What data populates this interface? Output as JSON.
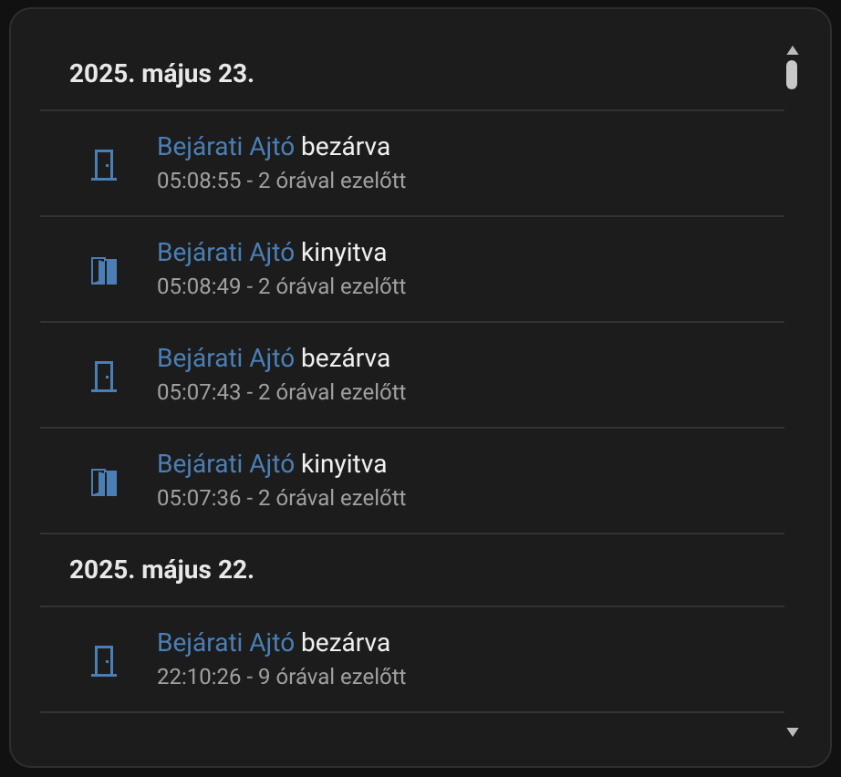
{
  "groups": [
    {
      "date": "2025. május 23.",
      "entries": [
        {
          "entity": "Bejárati Ajtó",
          "state": "bezárva",
          "kind": "closed",
          "time": "05:08:55 - 2 órával ezelőtt"
        },
        {
          "entity": "Bejárati Ajtó",
          "state": "kinyitva",
          "kind": "open",
          "time": "05:08:49 - 2 órával ezelőtt"
        },
        {
          "entity": "Bejárati Ajtó",
          "state": "bezárva",
          "kind": "closed",
          "time": "05:07:43 - 2 órával ezelőtt"
        },
        {
          "entity": "Bejárati Ajtó",
          "state": "kinyitva",
          "kind": "open",
          "time": "05:07:36 - 2 órával ezelőtt"
        }
      ]
    },
    {
      "date": "2025. május 22.",
      "entries": [
        {
          "entity": "Bejárati Ajtó",
          "state": "bezárva",
          "kind": "closed",
          "time": "22:10:26 - 9 órával ezelőtt"
        }
      ]
    }
  ]
}
